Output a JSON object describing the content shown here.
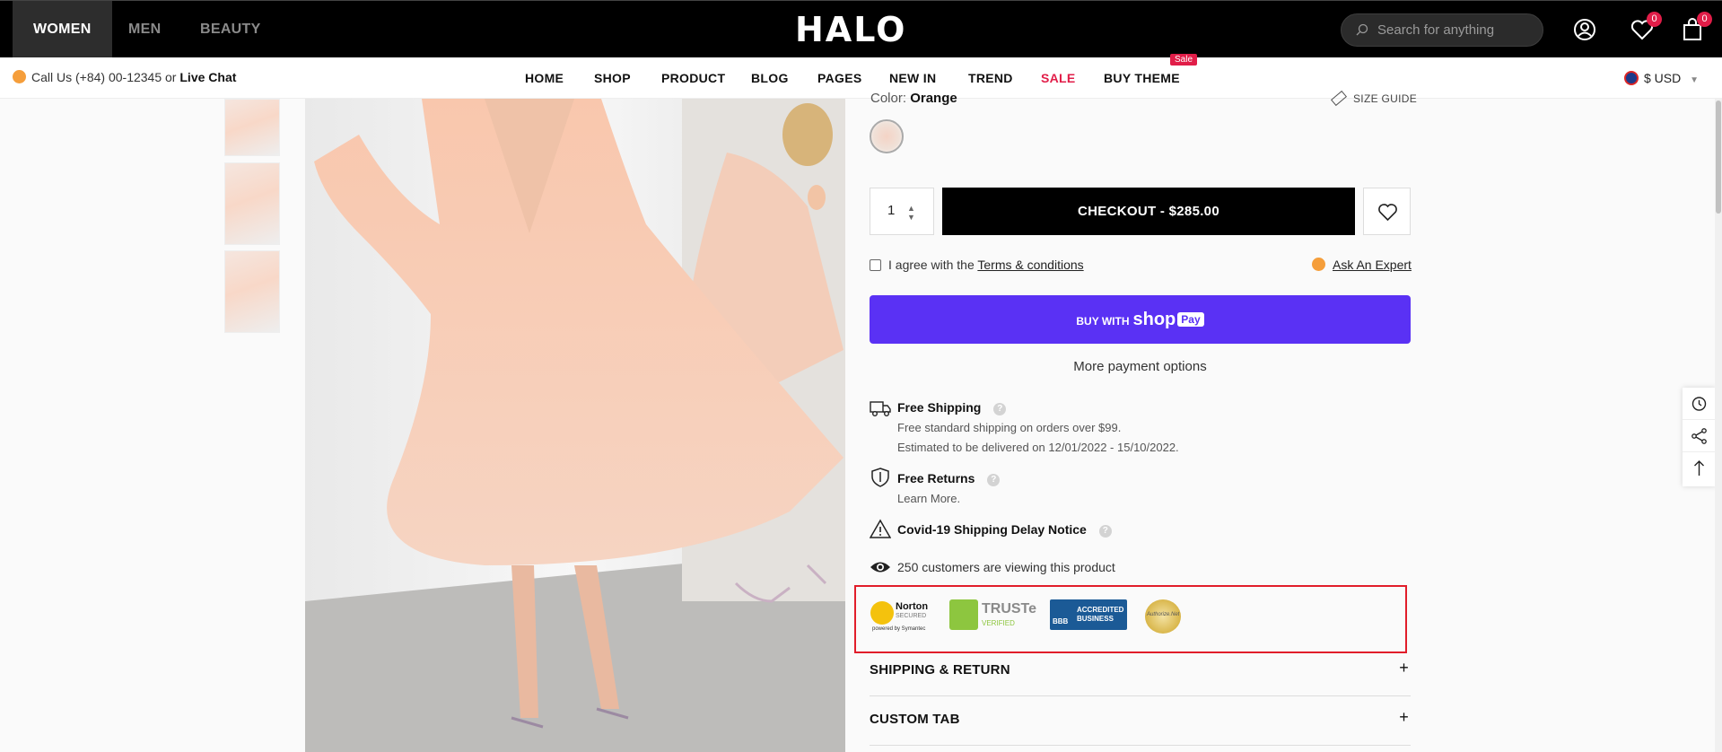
{
  "header": {
    "gender_tabs": [
      "WOMEN",
      "MEN",
      "BEAUTY"
    ],
    "logo": "HALO",
    "search_placeholder": "Search for anything",
    "wishlist_count": "0",
    "cart_count": "0"
  },
  "nav": {
    "call_prefix": "Call Us (+84) 00-12345 or",
    "live_chat": "Live Chat",
    "items": [
      "HOME",
      "SHOP",
      "PRODUCT",
      "BLOG",
      "PAGES",
      "NEW IN",
      "TREND",
      "SALE",
      "BUY THEME"
    ],
    "sale_badge": "Sale",
    "currency": "$ USD"
  },
  "product": {
    "color_prefix": "Color:",
    "color_value": "Orange",
    "size_guide": "SIZE GUIDE",
    "quantity": "1",
    "checkout_label": "CHECKOUT - $285.00",
    "agree_prefix": "I agree with the",
    "terms_link": "Terms & conditions",
    "ask_expert": "Ask An Expert",
    "shoppay_prefix": "BUY WITH",
    "shoppay_brand": "shop",
    "shoppay_pay": "Pay",
    "more_payment": "More payment options"
  },
  "info": {
    "shipping_title": "Free Shipping",
    "shipping_line1": "Free standard shipping on orders over $99.",
    "shipping_line2": "Estimated to be delivered on 12/01/2022 - 15/10/2022.",
    "returns_title": "Free Returns",
    "returns_line": "Learn More.",
    "covid_title": "Covid-19 Shipping Delay Notice",
    "viewers": "250 customers are viewing this product"
  },
  "trust": {
    "norton": "Norton",
    "norton_secured": "SECURED",
    "norton_by": "powered by Symantec",
    "truste": "TRUSTe",
    "truste_verified": "VERIFIED",
    "bbb": "BBB",
    "bbb_text1": "ACCREDITED",
    "bbb_text2": "BUSINESS",
    "authorize": "Authorize.Net"
  },
  "accordions": [
    "SHIPPING & RETURN",
    "CUSTOM TAB"
  ]
}
